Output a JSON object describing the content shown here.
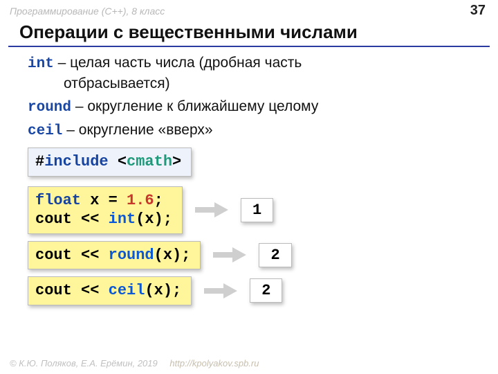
{
  "header": {
    "course": "Программирование (C++), 8 класс",
    "page": "37"
  },
  "title": "Операции с вещественными числами",
  "defs": {
    "int_kw": "int",
    "int_text": " – целая часть числа (дробная часть",
    "int_cont": "отбрасывается)",
    "round_kw": "round",
    "round_text": " – округление к ближайшему целому",
    "ceil_kw": "ceil",
    "ceil_text": " – округление «вверх»"
  },
  "code": {
    "include_pre": "#",
    "include_kw": "include",
    "include_sp": " ",
    "include_open": "<",
    "include_lib": "cmath",
    "include_close": ">",
    "l1_float": "float",
    "l1_rest1": " x = ",
    "l1_lit": "1.6",
    "l1_semi": ";",
    "l2_cout": "cout << ",
    "l2_fn": "int",
    "l2_arg": "(x)",
    "l2_semi": ";",
    "round_cout": "cout << ",
    "round_fn": "round",
    "round_arg": "(x)",
    "round_semi": ";",
    "ceil_cout": "cout << ",
    "ceil_fn": "ceil",
    "ceil_arg": "(x)",
    "ceil_semi": ";"
  },
  "results": {
    "int": "1",
    "round": "2",
    "ceil": "2"
  },
  "footer": {
    "copyright": "© К.Ю. Поляков, Е.А. Ерёмин, 2019",
    "url": "http://kpolyakov.spb.ru"
  }
}
